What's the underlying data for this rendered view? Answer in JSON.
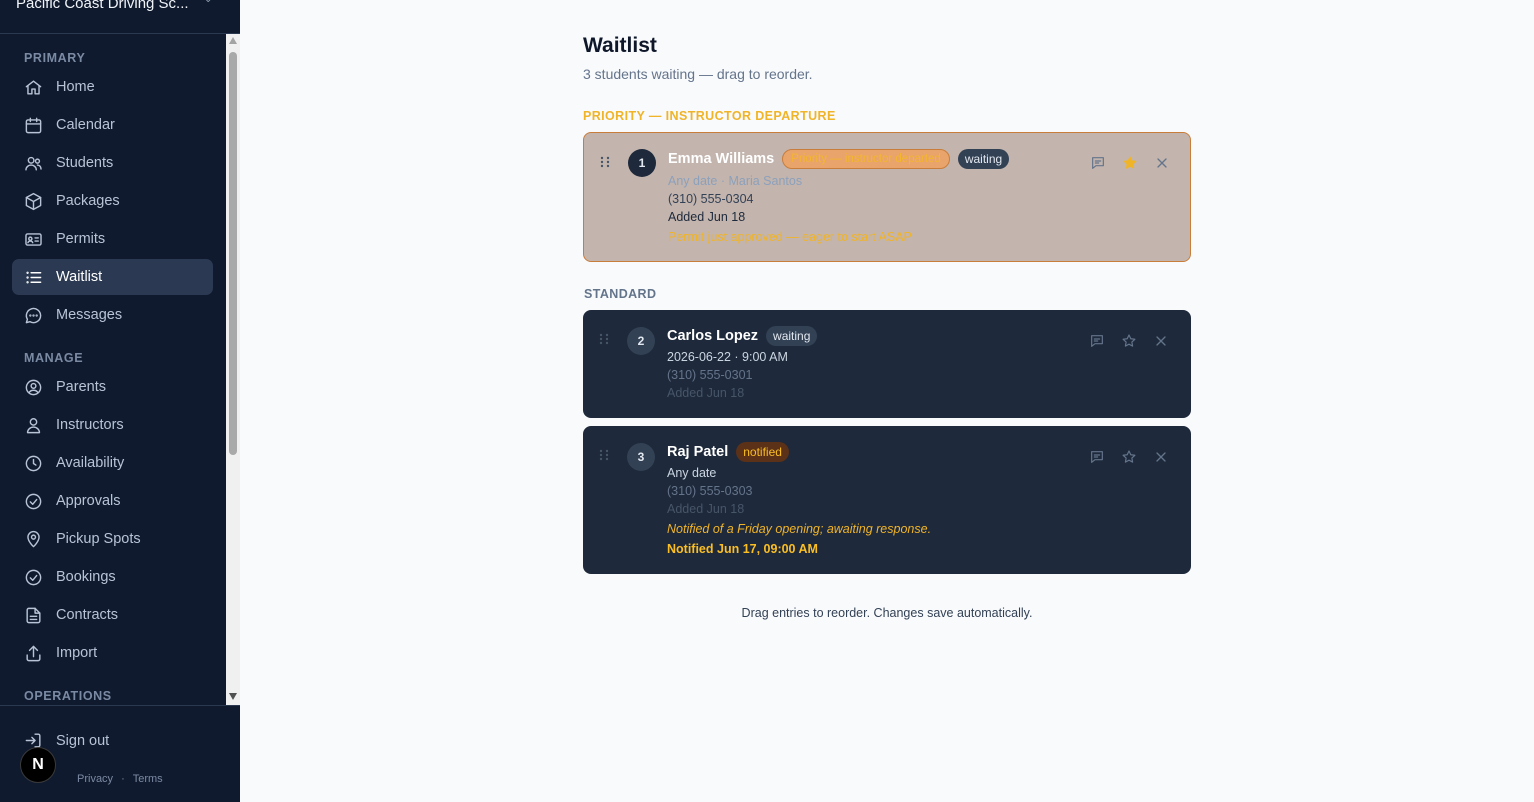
{
  "sidebar": {
    "org_name": "Pacific Coast Driving Sc...",
    "sections": {
      "primary": "PRIMARY",
      "manage": "MANAGE",
      "operations": "OPERATIONS"
    },
    "primary_items": [
      {
        "label": "Home",
        "icon": "home-icon"
      },
      {
        "label": "Calendar",
        "icon": "calendar-icon"
      },
      {
        "label": "Students",
        "icon": "students-icon"
      },
      {
        "label": "Packages",
        "icon": "package-icon"
      },
      {
        "label": "Permits",
        "icon": "id-card-icon"
      },
      {
        "label": "Waitlist",
        "icon": "list-icon",
        "active": true
      },
      {
        "label": "Messages",
        "icon": "chat-icon"
      }
    ],
    "manage_items": [
      {
        "label": "Parents",
        "icon": "user-circle-icon"
      },
      {
        "label": "Instructors",
        "icon": "user-icon"
      },
      {
        "label": "Availability",
        "icon": "clock-icon"
      },
      {
        "label": "Approvals",
        "icon": "check-circle-icon"
      },
      {
        "label": "Pickup Spots",
        "icon": "map-pin-icon"
      },
      {
        "label": "Bookings",
        "icon": "check-circle-icon"
      },
      {
        "label": "Contracts",
        "icon": "file-icon"
      },
      {
        "label": "Import",
        "icon": "upload-icon"
      }
    ],
    "sign_out": "Sign out",
    "privacy": "Privacy",
    "terms": "Terms",
    "separator": "·",
    "n_badge": "N"
  },
  "page": {
    "title": "Waitlist",
    "subtitle": "3 students waiting — drag to reorder.",
    "priority_section": "PRIORITY — INSTRUCTOR DEPARTURE",
    "standard_section": "STANDARD",
    "footer_note": "Drag entries to reorder. Changes save automatically."
  },
  "entries": [
    {
      "position": "1",
      "name": "Emma Williams",
      "priority_badge": "Priority — instructor departed",
      "status": "waiting",
      "when": "Any date · Maria Santos",
      "phone": "(310) 555-0304",
      "added": "Added Jun 18",
      "note": "Permit just approved — eager to start ASAP",
      "starred": true
    },
    {
      "position": "2",
      "name": "Carlos Lopez",
      "status": "waiting",
      "when": "2026-06-22 · 9:00 AM",
      "phone": "(310) 555-0301",
      "added": "Added Jun 18",
      "starred": false
    },
    {
      "position": "3",
      "name": "Raj Patel",
      "status": "notified",
      "when": "Any date",
      "phone": "(310) 555-0303",
      "added": "Added Jun 18",
      "note": "Notified of a Friday opening; awaiting response.",
      "notified_at": "Notified Jun 17, 09:00 AM",
      "starred": false
    }
  ],
  "colors": {
    "sidebar_bg": "#0f1a2e",
    "card_bg": "#1e293b",
    "priority_card_bg": "#c3b5ae",
    "accent_amber": "#f0b429"
  }
}
